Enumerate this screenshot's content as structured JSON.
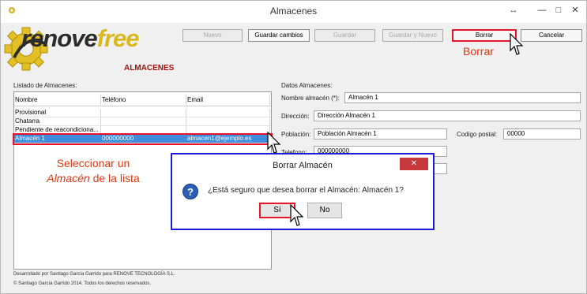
{
  "window": {
    "title": "Almacenes",
    "restore_glyph": "↔",
    "minimize_glyph": "—",
    "maximize_glyph": "□",
    "close_glyph": "✕"
  },
  "brand": {
    "logo_text_part1": "renove",
    "logo_text_part2": "free",
    "section_title": "ALMACENES"
  },
  "toolbar": {
    "nuevo": "Nuevo",
    "guardar_cambios": "Guardar cambios",
    "guardar": "Guardar",
    "guardar_y_nuevo": "Guardar y Nuevo",
    "borrar": "Borrar",
    "cancelar": "Cancelar"
  },
  "annotations": {
    "borrar_callout": "Borrar",
    "select_line1": "Seleccionar un",
    "select_line2_italic": "Almacén",
    "select_line2_rest": " de la lista"
  },
  "list": {
    "title": "Listado de Almacenes:",
    "columns": [
      "Nombre",
      "Teléfono",
      "Email"
    ],
    "rows": [
      [
        "Provisional",
        "",
        ""
      ],
      [
        "Chatarra",
        "",
        ""
      ],
      [
        "Pendiente de reacondiciona...",
        "",
        ""
      ],
      [
        "Almacén 1",
        "000000000",
        "almacen1@ejemplo.es"
      ]
    ],
    "selected_index": 3
  },
  "form": {
    "title": "Datos Almacenes:",
    "nombre_label": "Nombre almacén (*):",
    "nombre_value": "Almacén 1",
    "direccion_label": "Dirección:",
    "direccion_value": "Dirección Almacén 1",
    "poblacion_label": "Población:",
    "poblacion_value": "Población Almacén 1",
    "cp_label": "Codigo postal:",
    "cp_value": "00000",
    "telefono_label": "Telefono:",
    "telefono_value": "000000000"
  },
  "dialog": {
    "title": "Borrar Almacén",
    "message": "¿Está seguro que desea borrar el Almacén: Almacén 1?",
    "yes": "Sí",
    "no": "No",
    "close_glyph": "✕",
    "icon_glyph": "?"
  },
  "footer": {
    "line1": "Desarrollado por Santiago García Garrido para RENOVE TECNOLOGÍA S.L.",
    "line2": "© Santiago García Garrido 2014. Todos los derechos reservados."
  },
  "colors": {
    "accent_red": "#e0360f",
    "selection_blue": "#3e8ddd",
    "dialog_border": "#1b18e0",
    "highlight_red": "#e8142a"
  }
}
